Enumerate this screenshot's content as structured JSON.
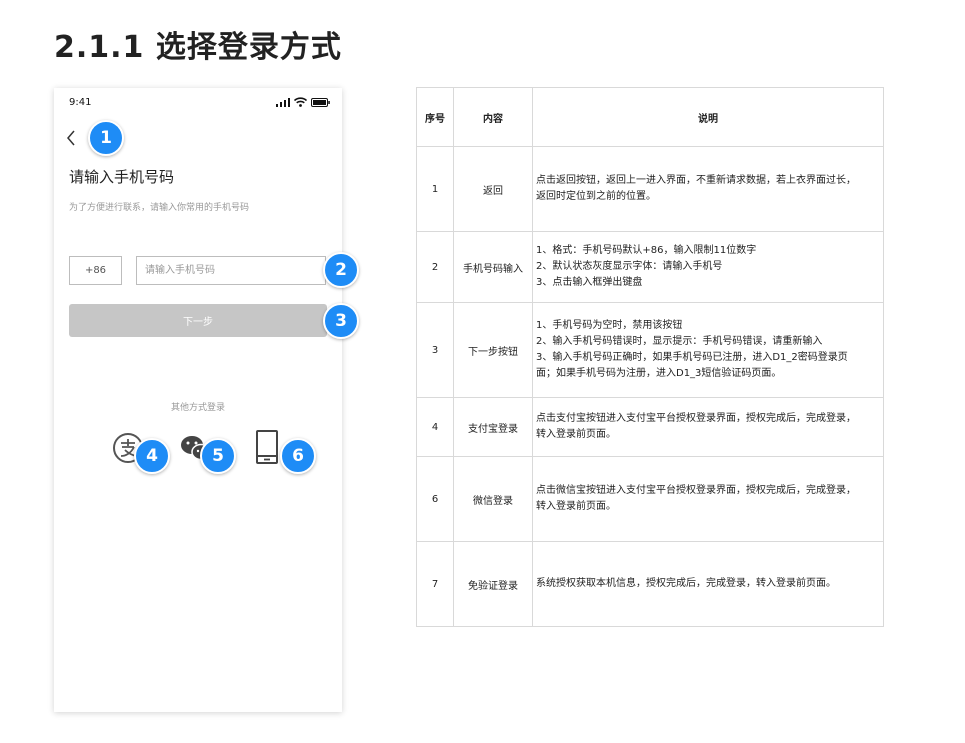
{
  "page_title": "2.1.1  选择登录方式",
  "phone": {
    "status_time": "9:41",
    "heading": "请输入手机号码",
    "subheading": "为了方便进行联系，请输入你常用的手机号码",
    "country_code": "+86",
    "phone_placeholder": "请输入手机号码",
    "next_label": "下一步",
    "other_login_label": "其他方式登录",
    "icons": [
      "back-icon",
      "alipay-icon",
      "wechat-icon",
      "mobile-device-icon"
    ]
  },
  "badges": [
    "1",
    "2",
    "3",
    "4",
    "5",
    "6"
  ],
  "table": {
    "headers": [
      "序号",
      "内容",
      "说明"
    ],
    "rows": [
      {
        "no": "1",
        "content": "返回",
        "desc": [
          "点击返回按钮，返回上一进入界面，不重新请求数据，若上衣界面过长，",
          "返回时定位到之前的位置。"
        ]
      },
      {
        "no": "2",
        "content": "手机号码输入",
        "desc": [
          "1、格式：手机号码默认+86，输入限制11位数字",
          "2、默认状态灰度显示字体：请输入手机号",
          "3、点击输入框弹出键盘"
        ]
      },
      {
        "no": "3",
        "content": "下一步按钮",
        "desc": [
          "1、手机号码为空时，禁用该按钮",
          "2、输入手机号码错误时，显示提示：手机号码错误，请重新输入",
          "3、输入手机号码正确时，如果手机号码已注册，进入D1_2密码登录页",
          "面；如果手机号码为注册，进入D1_3短信验证码页面。"
        ]
      },
      {
        "no": "4",
        "content": "支付宝登录",
        "desc": [
          "点击支付宝按钮进入支付宝平台授权登录界面，授权完成后，完成登录，",
          "转入登录前页面。"
        ]
      },
      {
        "no": "6",
        "content": "微信登录",
        "desc": [
          "点击微信宝按钮进入支付宝平台授权登录界面，授权完成后，完成登录，",
          "转入登录前页面。"
        ]
      },
      {
        "no": "7",
        "content": "免验证登录",
        "desc": [
          "系统授权获取本机信息，授权完成后，完成登录，转入登录前页面。"
        ]
      }
    ]
  },
  "colors": {
    "badge": "#1e8cf6",
    "button_disabled": "#c6c6c6",
    "border": "#d9d9d9"
  }
}
